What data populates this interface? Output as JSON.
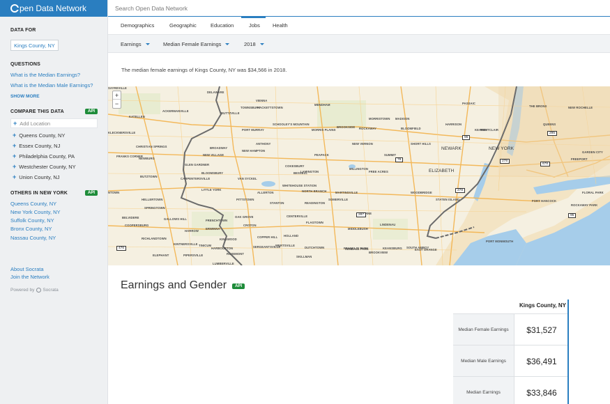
{
  "logo": {
    "text": "pen Data Network"
  },
  "search": {
    "placeholder": "Search Open Data Network"
  },
  "sidebar": {
    "data_for_label": "DATA FOR",
    "location": "Kings County, NY",
    "questions_label": "QUESTIONS",
    "questions": [
      {
        "prefix": "What is the ",
        "highlight": "Median Earnings",
        "suffix": "?"
      },
      {
        "prefix": "What is the ",
        "highlight": "Median Male Earnings",
        "suffix": "?"
      }
    ],
    "show_more": "SHOW MORE",
    "compare_label": "COMPARE THIS DATA",
    "api_label": "API",
    "add_location": "Add Location",
    "compare_items": [
      "Queens County, NY",
      "Essex County, NJ",
      "Philadelphia County, PA",
      "Westchester County, NY",
      "Union County, NJ"
    ],
    "others_label": "OTHERS IN NEW YORK",
    "others": [
      "Queens County, NY",
      "New York County, NY",
      "Suffolk County, NY",
      "Bronx County, NY",
      "Nassau County, NY"
    ],
    "about": "About Socrata",
    "join": "Join the Network",
    "powered_by": "Powered by",
    "socrata": "Socrata"
  },
  "tabs": [
    "Demographics",
    "Geographic",
    "Education",
    "Jobs",
    "Health"
  ],
  "active_tab": "Jobs",
  "filters": {
    "category": "Earnings",
    "metric": "Median Female Earnings",
    "year": "2018"
  },
  "summary": "The median female earnings of Kings County, NY was $34,566 in 2018.",
  "map": {
    "zoom_in": "+",
    "zoom_out": "−",
    "labels": [
      "DELAWARE",
      "VIENNA",
      "HACKETTSTOWN",
      "MENDHAM",
      "MORRISTOWN",
      "MADISON",
      "PASSAIC",
      "THE BRONX",
      "NEW ROCHELLE",
      "KATELLEN",
      "ACKERMANVILLE",
      "BUTTZVILLE",
      "TOWNSBURY",
      "MORRIS PLAINS",
      "ROCKAWAY",
      "MONTCLAIR",
      "PORT MURRAY",
      "SCHOOLEY'S MOUNTAIN",
      "BROOKSIDE",
      "BLOOMFIELD",
      "HARRISON",
      "KEARNY",
      "KLECKNERSVILLE",
      "CHRISTIAN SPRINGS",
      "BROADWAY",
      "NEW HAMPTON",
      "ANTHONY",
      "SHORT HILLS",
      "NEW VERNON",
      "FRANKS CORNER",
      "NEWBURG",
      "NEW VILLAGE",
      "GLEN GARDNER",
      "PEAPACK",
      "SUMMIT",
      "NEWARK",
      "NEW YORK",
      "BUTZTOWN",
      "CARPENTERSVILLE",
      "BLOOMSBURY",
      "VAN SYCKEL",
      "COKESBURY",
      "BESSELL",
      "LAMINGTON",
      "MILLINGTON",
      "FREE ACRES",
      "ELIZABETH",
      "NTOWN",
      "LITTLE YORK",
      "WHITEHOUSE STATION",
      "NORTH BRANCH",
      "MARTINSVILLE",
      "PITTSTOWN",
      "ALLERTON",
      "STANTON",
      "READINGTON",
      "SOMERVILLE",
      "WOODBRIDGE",
      "STATEN ISLAND",
      "HELLERTOWN",
      "SPRINGTOWN",
      "BELVIDERE",
      "FRENCHTOWN",
      "OAK GROVE",
      "CROTON",
      "CENTERVILLE",
      "FLAGTOWN",
      "FINDERNE",
      "COOPERSBURG",
      "GALLOWS HILL",
      "HARROW",
      "ERWINNA",
      "KINGWOOD",
      "COPPER HILL",
      "HOLLAND",
      "MIDDLEBUSH",
      "LINDENAU",
      "RICHLANDTOWN",
      "KINTNERSVILLE",
      "TINICUM",
      "HARBOURTON",
      "ROSEMONT",
      "DUTCHTOWN",
      "KENDALL PARK",
      "KEANSBURG",
      "ELEPHANT",
      "PIPERSVILLE",
      "LUMBERVILLE",
      "SERGEANTSVILLE",
      "WERTSVILLE",
      "SKILLMAN",
      "FRANKLIN PARK",
      "BROOKVIEW",
      "SOUTH AMBOY",
      "PORT MONMOUTH",
      "FORT HANCOCK",
      "ROCKAWAY PARK",
      "FLORAL PARK",
      "GARDEN CITY",
      "FREEPORT",
      "QUEENS",
      "EAST ORANGE",
      "SAYREVILLE"
    ],
    "shields": [
      "95",
      "295",
      "95",
      "78",
      "278",
      "678",
      "278",
      "287",
      "476"
    ]
  },
  "section": {
    "title": "Earnings and Gender",
    "api_label": "API"
  },
  "table": {
    "county": "Kings County, NY",
    "rows": [
      {
        "label": "Median Female Earnings",
        "value": "$31,527"
      },
      {
        "label": "Median Male Earnings",
        "value": "$36,491"
      },
      {
        "label": "Median Earnings",
        "value": "$33,846"
      }
    ]
  },
  "colors": {
    "accent": "#2a7ec0",
    "api_green": "#1e8c3a",
    "water": "#a6cdea",
    "land": "#f5f0e1",
    "road": "#f3b34c"
  }
}
